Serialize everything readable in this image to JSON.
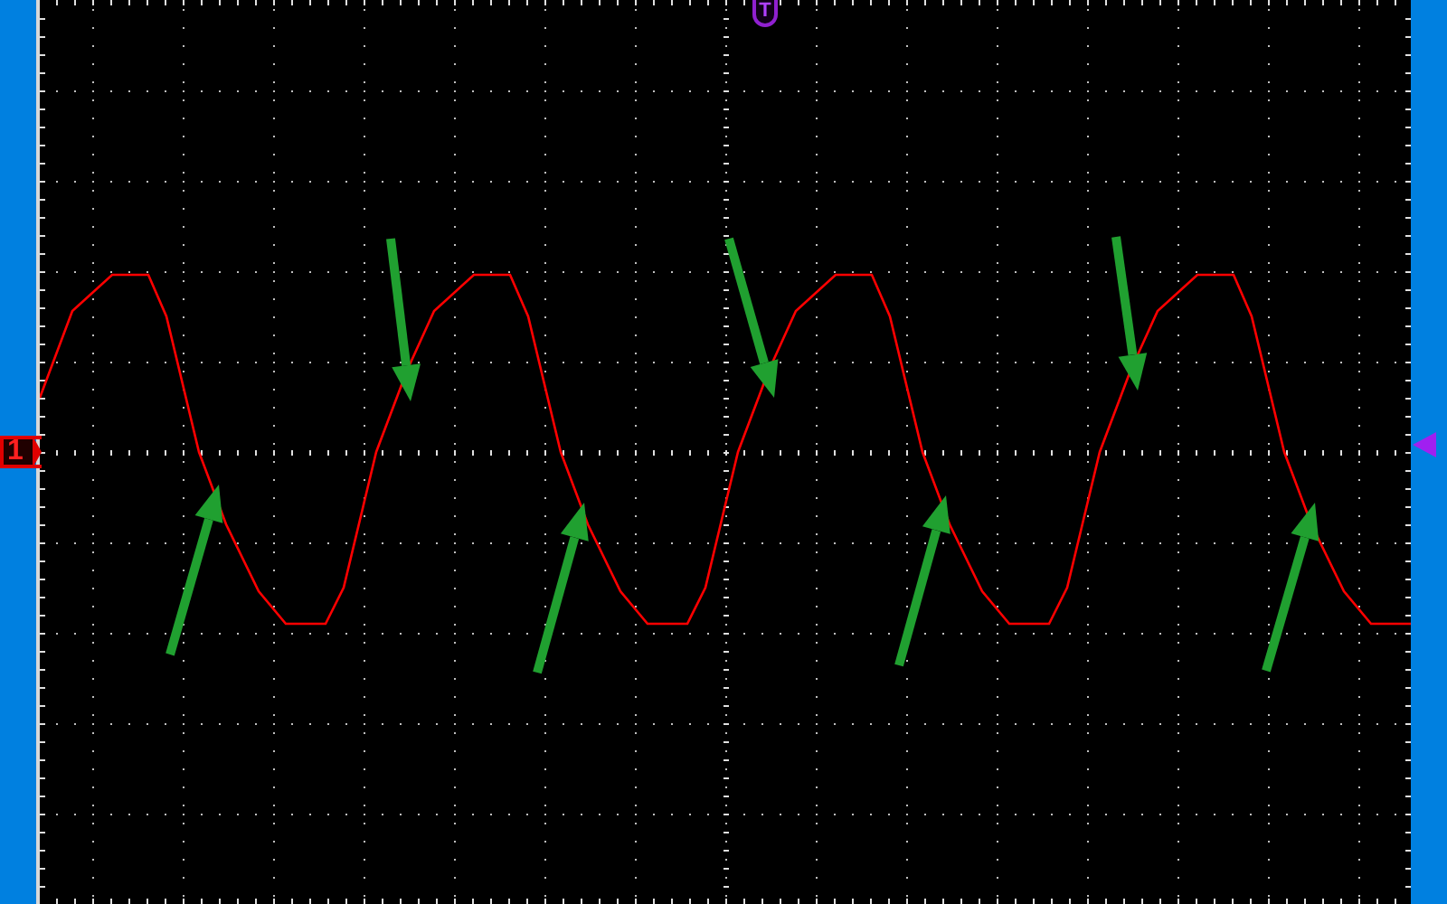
{
  "channel_marker": {
    "label": "1"
  },
  "trigger_marker": {
    "label": "T"
  }
}
